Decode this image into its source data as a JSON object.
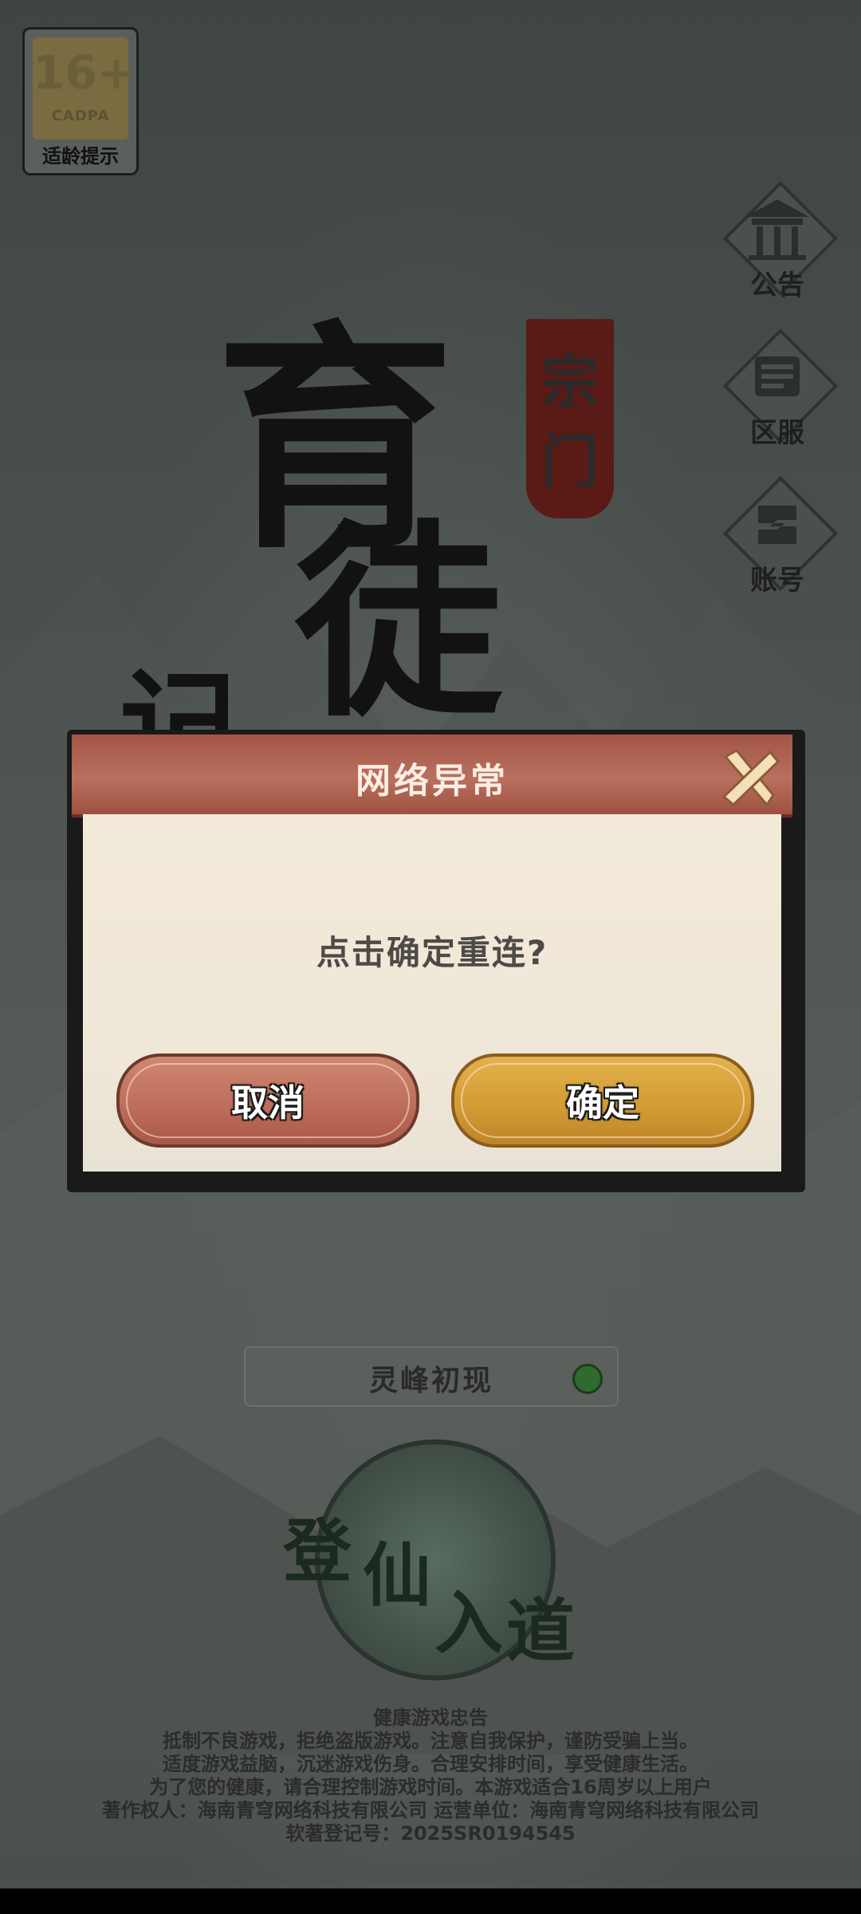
{
  "age_rating": {
    "number": "16+",
    "org": "CADPA",
    "caption": "适龄提示"
  },
  "side_nav": [
    {
      "label": "公告",
      "icon": "pavilion-icon"
    },
    {
      "label": "区服",
      "icon": "scroll-icon"
    },
    {
      "label": "账号",
      "icon": "account-icon"
    }
  ],
  "title_art": {
    "chars": [
      "育",
      "徒",
      "记"
    ],
    "seal": [
      "宗",
      "门"
    ]
  },
  "dialog": {
    "title": "网络异常",
    "message": "点击确定重连?",
    "cancel_label": "取消",
    "confirm_label": "确定"
  },
  "server": {
    "name": "灵峰初现",
    "status_color": "#2f6a2f"
  },
  "enter": {
    "chars": [
      "登",
      "仙",
      "入",
      "道"
    ]
  },
  "notice": {
    "heading": "健康游戏忠告",
    "lines": [
      "抵制不良游戏，拒绝盗版游戏。注意自我保护，谨防受骗上当。",
      "适度游戏益脑，沉迷游戏伤身。合理安排时间，享受健康生活。",
      "为了您的健康，请合理控制游戏时间。本游戏适合16周岁以上用户",
      "著作权人：海南青穹网络科技有限公司    运营单位：海南青穹网络科技有限公司",
      "软著登记号：2025SR0194545"
    ]
  }
}
